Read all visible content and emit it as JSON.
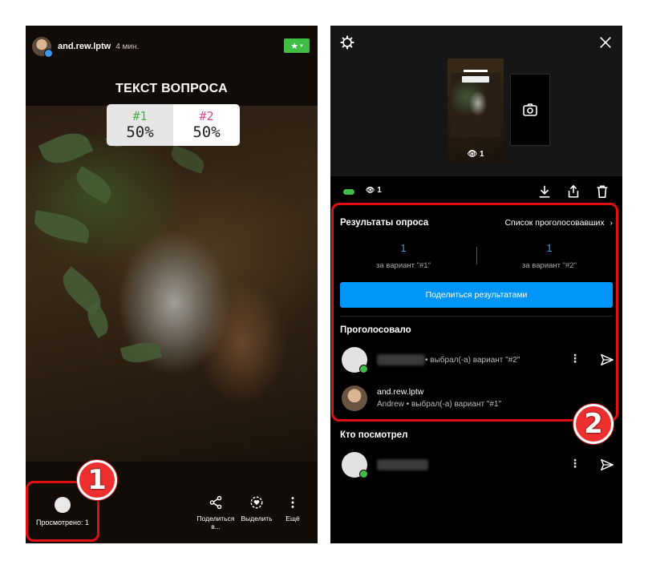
{
  "left_story": {
    "username": "and.rew.lptw",
    "time_ago": "4 мин.",
    "close_friends_icon": "star-icon",
    "poll": {
      "question": "ТЕКСТ ВОПРОСА",
      "options": [
        {
          "label": "#1",
          "percent": "50%",
          "color": "#46b04a"
        },
        {
          "label": "#2",
          "percent": "50%",
          "color": "#e14a8a"
        }
      ]
    },
    "viewed_label": "Просмотрено: 1",
    "actions": [
      {
        "label": "Поделиться в...",
        "icon": "share-icon"
      },
      {
        "label": "Выделить",
        "icon": "highlight-icon"
      },
      {
        "label": "Ещё",
        "icon": "more-vertical-icon"
      }
    ]
  },
  "right_panel": {
    "thumb_views": "1",
    "views_count": "1",
    "poll_results": {
      "title": "Результаты опроса",
      "voters_link": "Список проголосовавших",
      "counts": [
        {
          "value": "1",
          "label": "за вариант \"#1\""
        },
        {
          "value": "1",
          "label": "за вариант \"#2\""
        }
      ],
      "share_button": "Поделиться результатами"
    },
    "voted_section": {
      "title": "Проголосовало",
      "voters": [
        {
          "name": "",
          "choice": "• выбрал(-а) вариант \"#2\""
        },
        {
          "name": "and.rew.lptw",
          "subtitle": "Andrew • выбрал(-а) вариант \"#1\""
        }
      ]
    },
    "viewed_section": {
      "title": "Кто посмотрел"
    }
  },
  "annotations": {
    "badge_1": "1",
    "badge_2": "2",
    "frame_color": "#e10f14"
  },
  "colors": {
    "accent_blue": "#0095f6",
    "online_green": "#3fbd45"
  }
}
